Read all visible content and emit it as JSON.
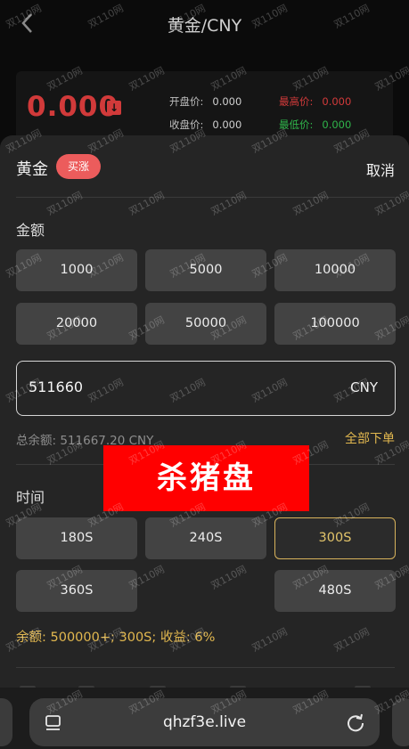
{
  "background": {
    "title": "黄金/CNY",
    "price": "0.000",
    "stats": [
      {
        "label": "开盘价:",
        "value": "0.000",
        "color": "#cfcfcf"
      },
      {
        "label": "最高价:",
        "value": "0.000",
        "color": "#d13a3a"
      },
      {
        "label": "收盘价:",
        "value": "0.000",
        "color": "#cfcfcf"
      },
      {
        "label": "最低价:",
        "value": "0.000",
        "color": "#2fb44a"
      }
    ]
  },
  "sheet": {
    "title": "黄金",
    "badge": "买涨",
    "cancel": "取消",
    "amount_section": "金额",
    "amount_options": [
      "1000",
      "5000",
      "10000",
      "20000",
      "50000",
      "100000"
    ],
    "amount_value": "511660",
    "amount_unit": "CNY",
    "balance_text": "总余额: 511667.20 CNY",
    "all_in": "全部下单",
    "time_section": "时间",
    "time_options": [
      "180S",
      "240S",
      "300S",
      "360S",
      "480S"
    ],
    "selected_time": "300S",
    "info_line": "余额: 500000+; 300S; 收益: 6%"
  },
  "banner": "杀猪盘",
  "browser": {
    "url": "qhzf3e.live"
  },
  "watermark": "双110网",
  "colors": {
    "accent_gold": "#e2b84f",
    "badge_red": "#ec5c5c",
    "banner_red": "#ff0000"
  }
}
